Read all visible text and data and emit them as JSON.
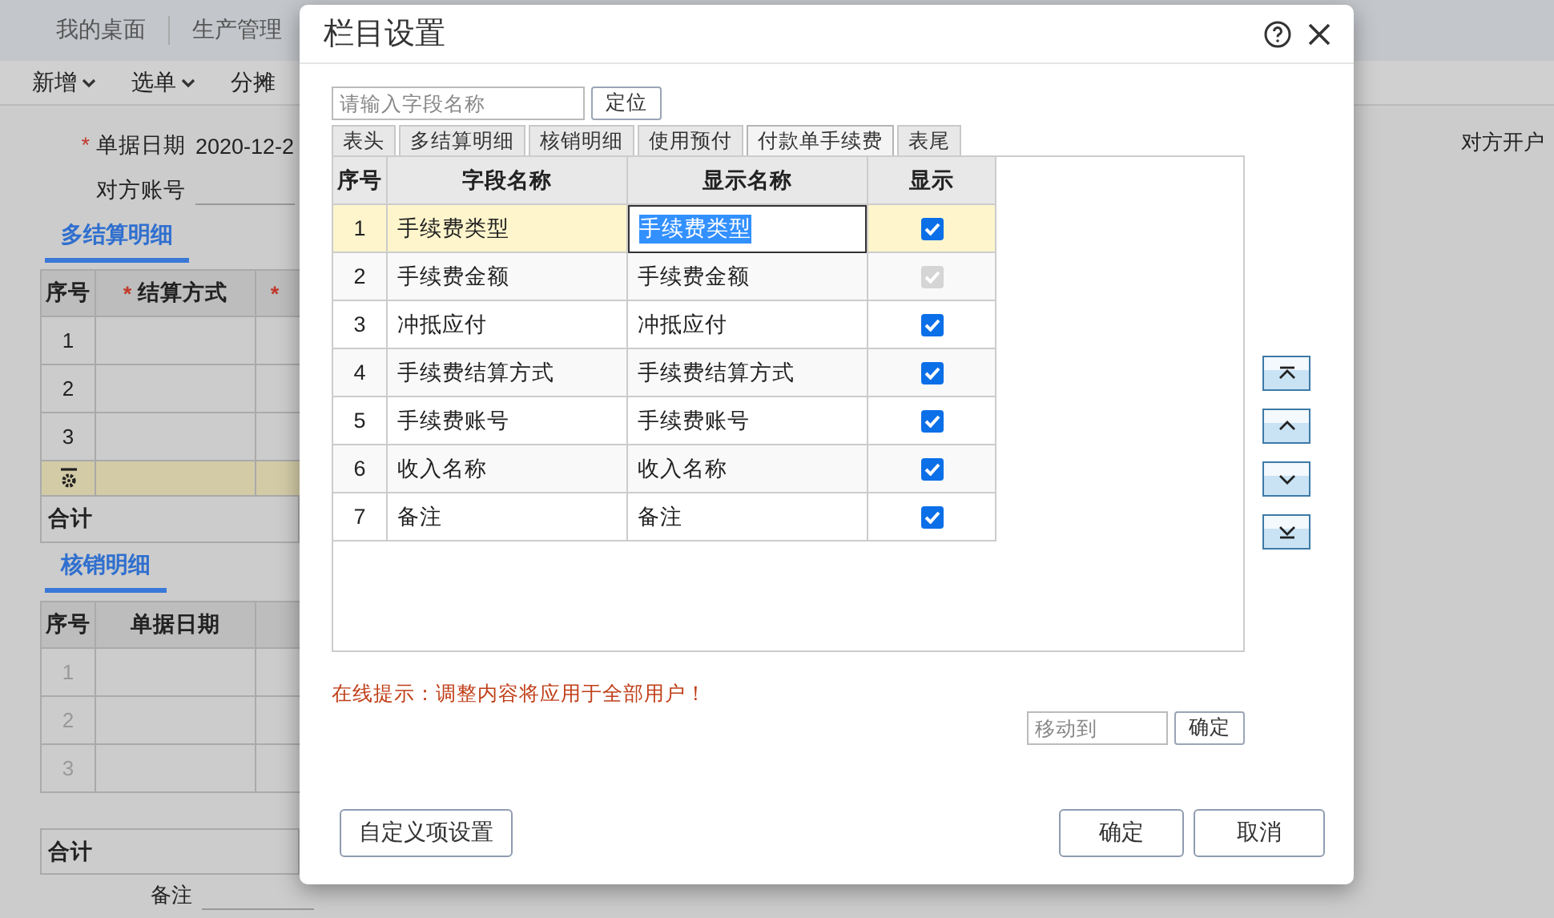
{
  "nav": {
    "tabs": [
      "我的桌面",
      "生产管理"
    ]
  },
  "toolbar": [
    {
      "label": "新增",
      "dropdown": true
    },
    {
      "label": "选单",
      "dropdown": true
    },
    {
      "label": "分摊",
      "dropdown": false
    }
  ],
  "form": {
    "fields": [
      {
        "mark": "*",
        "label": "单据日期",
        "value": "2020-12-2"
      },
      {
        "label": "对方账号"
      }
    ],
    "right_label": "对方开户"
  },
  "settlement": {
    "title": "多结算明细",
    "columns": [
      {
        "label": "序号"
      },
      {
        "mark": "*",
        "label": "结算方式"
      },
      {
        "mark": "*"
      }
    ],
    "rows": [
      "1",
      "2",
      "3"
    ],
    "total_label": "合计"
  },
  "writeoff": {
    "title": "核销明细",
    "columns": [
      {
        "label": "序号"
      },
      {
        "label": "单据日期"
      }
    ],
    "rows": [
      "1",
      "2",
      "3"
    ],
    "total_label": "合计"
  },
  "remark_label": "备注",
  "dialog": {
    "title": "栏目设置",
    "search": {
      "placeholder": "请输入字段名称",
      "button": "定位"
    },
    "tabs": [
      {
        "label": "表头",
        "selected": false
      },
      {
        "label": "多结算明细",
        "selected": false
      },
      {
        "label": "核销明细",
        "selected": false
      },
      {
        "label": "使用预付",
        "selected": false
      },
      {
        "label": "付款单手续费",
        "selected": true
      },
      {
        "label": "表尾",
        "selected": false
      }
    ],
    "table": {
      "columns": [
        "序号",
        "字段名称",
        "显示名称",
        "显示"
      ],
      "rows": [
        {
          "index": "1",
          "field": "手续费类型",
          "display": "手续费类型",
          "shown": true,
          "disabled": false,
          "selected": true
        },
        {
          "index": "2",
          "field": "手续费金额",
          "display": "手续费金额",
          "shown": true,
          "disabled": true,
          "selected": false
        },
        {
          "index": "3",
          "field": "冲抵应付",
          "display": "冲抵应付",
          "shown": true,
          "disabled": false,
          "selected": false
        },
        {
          "index": "4",
          "field": "手续费结算方式",
          "display": "手续费结算方式",
          "shown": true,
          "disabled": false,
          "selected": false
        },
        {
          "index": "5",
          "field": "手续费账号",
          "display": "手续费账号",
          "shown": true,
          "disabled": false,
          "selected": false
        },
        {
          "index": "6",
          "field": "收入名称",
          "display": "收入名称",
          "shown": true,
          "disabled": false,
          "selected": false
        },
        {
          "index": "7",
          "field": "备注",
          "display": "备注",
          "shown": true,
          "disabled": false,
          "selected": false
        }
      ]
    },
    "hint": "在线提示：调整内容将应用于全部用户！",
    "move": {
      "placeholder": "移动到",
      "button": "确定"
    },
    "buttons": {
      "custom": "自定义项设置",
      "ok": "确定",
      "cancel": "取消"
    }
  }
}
